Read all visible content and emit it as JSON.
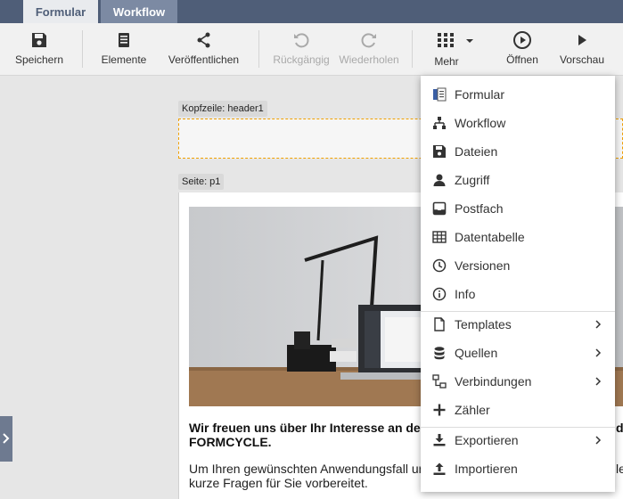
{
  "tabs": [
    {
      "label": "Formular"
    },
    {
      "label": "Workflow"
    }
  ],
  "toolbar": {
    "save": "Speichern",
    "elements": "Elemente",
    "publish": "Veröffentlichen",
    "undo": "Rückgängig",
    "redo": "Wiederholen",
    "more": "Mehr",
    "open": "Öffnen",
    "preview": "Vorschau"
  },
  "canvas": {
    "header_tag": "Kopfzeile: header1",
    "page_tag": "Seite: p1",
    "intro": "Wir freuen uns über Ihr Interesse an de",
    "intro_line2": "FORMCYCLE.",
    "intro_right": "de",
    "body_line1": "Um Ihren gewünschten Anwendungsfall ur",
    "body_line2": "kurze Fragen für Sie vorbereitet.",
    "body_right": "le"
  },
  "menu": {
    "items": [
      {
        "label": "Formular",
        "icon": "form-icon"
      },
      {
        "label": "Workflow",
        "icon": "sitemap-icon"
      },
      {
        "label": "Dateien",
        "icon": "save-icon"
      },
      {
        "label": "Zugriff",
        "icon": "user-icon"
      },
      {
        "label": "Postfach",
        "icon": "inbox-icon"
      },
      {
        "label": "Datentabelle",
        "icon": "table-icon"
      },
      {
        "label": "Versionen",
        "icon": "history-icon"
      },
      {
        "label": "Info",
        "icon": "info-icon"
      },
      {
        "label": "Templates",
        "icon": "file-icon"
      },
      {
        "label": "Quellen",
        "icon": "database-icon"
      },
      {
        "label": "Verbindungen",
        "icon": "network-icon"
      },
      {
        "label": "Zähler",
        "icon": "plus-icon"
      },
      {
        "label": "Exportieren",
        "icon": "download-icon"
      },
      {
        "label": "Importieren",
        "icon": "upload-icon"
      }
    ]
  },
  "colors": {
    "tabbar": "#4f5e78",
    "active_tab_bg": "#e9ebee",
    "inactive_tab_bg": "#7c8aa3",
    "header_border": "#f0a000",
    "icon": "#333333",
    "disabled": "#a9a9a9"
  }
}
